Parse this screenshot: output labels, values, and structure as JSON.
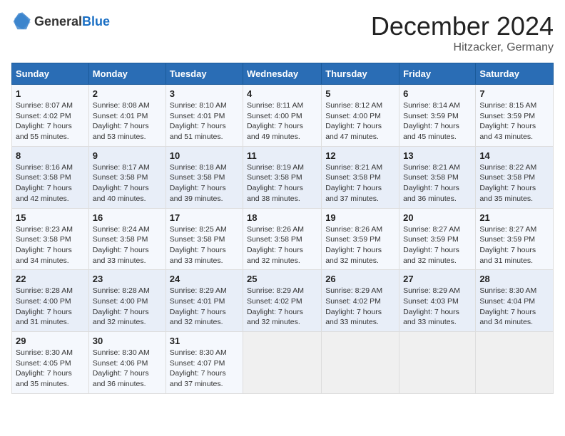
{
  "header": {
    "logo_general": "General",
    "logo_blue": "Blue",
    "month": "December 2024",
    "location": "Hitzacker, Germany"
  },
  "weekdays": [
    "Sunday",
    "Monday",
    "Tuesday",
    "Wednesday",
    "Thursday",
    "Friday",
    "Saturday"
  ],
  "weeks": [
    [
      {
        "day": "1",
        "sunrise": "Sunrise: 8:07 AM",
        "sunset": "Sunset: 4:02 PM",
        "daylight": "Daylight: 7 hours and 55 minutes."
      },
      {
        "day": "2",
        "sunrise": "Sunrise: 8:08 AM",
        "sunset": "Sunset: 4:01 PM",
        "daylight": "Daylight: 7 hours and 53 minutes."
      },
      {
        "day": "3",
        "sunrise": "Sunrise: 8:10 AM",
        "sunset": "Sunset: 4:01 PM",
        "daylight": "Daylight: 7 hours and 51 minutes."
      },
      {
        "day": "4",
        "sunrise": "Sunrise: 8:11 AM",
        "sunset": "Sunset: 4:00 PM",
        "daylight": "Daylight: 7 hours and 49 minutes."
      },
      {
        "day": "5",
        "sunrise": "Sunrise: 8:12 AM",
        "sunset": "Sunset: 4:00 PM",
        "daylight": "Daylight: 7 hours and 47 minutes."
      },
      {
        "day": "6",
        "sunrise": "Sunrise: 8:14 AM",
        "sunset": "Sunset: 3:59 PM",
        "daylight": "Daylight: 7 hours and 45 minutes."
      },
      {
        "day": "7",
        "sunrise": "Sunrise: 8:15 AM",
        "sunset": "Sunset: 3:59 PM",
        "daylight": "Daylight: 7 hours and 43 minutes."
      }
    ],
    [
      {
        "day": "8",
        "sunrise": "Sunrise: 8:16 AM",
        "sunset": "Sunset: 3:58 PM",
        "daylight": "Daylight: 7 hours and 42 minutes."
      },
      {
        "day": "9",
        "sunrise": "Sunrise: 8:17 AM",
        "sunset": "Sunset: 3:58 PM",
        "daylight": "Daylight: 7 hours and 40 minutes."
      },
      {
        "day": "10",
        "sunrise": "Sunrise: 8:18 AM",
        "sunset": "Sunset: 3:58 PM",
        "daylight": "Daylight: 7 hours and 39 minutes."
      },
      {
        "day": "11",
        "sunrise": "Sunrise: 8:19 AM",
        "sunset": "Sunset: 3:58 PM",
        "daylight": "Daylight: 7 hours and 38 minutes."
      },
      {
        "day": "12",
        "sunrise": "Sunrise: 8:21 AM",
        "sunset": "Sunset: 3:58 PM",
        "daylight": "Daylight: 7 hours and 37 minutes."
      },
      {
        "day": "13",
        "sunrise": "Sunrise: 8:21 AM",
        "sunset": "Sunset: 3:58 PM",
        "daylight": "Daylight: 7 hours and 36 minutes."
      },
      {
        "day": "14",
        "sunrise": "Sunrise: 8:22 AM",
        "sunset": "Sunset: 3:58 PM",
        "daylight": "Daylight: 7 hours and 35 minutes."
      }
    ],
    [
      {
        "day": "15",
        "sunrise": "Sunrise: 8:23 AM",
        "sunset": "Sunset: 3:58 PM",
        "daylight": "Daylight: 7 hours and 34 minutes."
      },
      {
        "day": "16",
        "sunrise": "Sunrise: 8:24 AM",
        "sunset": "Sunset: 3:58 PM",
        "daylight": "Daylight: 7 hours and 33 minutes."
      },
      {
        "day": "17",
        "sunrise": "Sunrise: 8:25 AM",
        "sunset": "Sunset: 3:58 PM",
        "daylight": "Daylight: 7 hours and 33 minutes."
      },
      {
        "day": "18",
        "sunrise": "Sunrise: 8:26 AM",
        "sunset": "Sunset: 3:58 PM",
        "daylight": "Daylight: 7 hours and 32 minutes."
      },
      {
        "day": "19",
        "sunrise": "Sunrise: 8:26 AM",
        "sunset": "Sunset: 3:59 PM",
        "daylight": "Daylight: 7 hours and 32 minutes."
      },
      {
        "day": "20",
        "sunrise": "Sunrise: 8:27 AM",
        "sunset": "Sunset: 3:59 PM",
        "daylight": "Daylight: 7 hours and 32 minutes."
      },
      {
        "day": "21",
        "sunrise": "Sunrise: 8:27 AM",
        "sunset": "Sunset: 3:59 PM",
        "daylight": "Daylight: 7 hours and 31 minutes."
      }
    ],
    [
      {
        "day": "22",
        "sunrise": "Sunrise: 8:28 AM",
        "sunset": "Sunset: 4:00 PM",
        "daylight": "Daylight: 7 hours and 31 minutes."
      },
      {
        "day": "23",
        "sunrise": "Sunrise: 8:28 AM",
        "sunset": "Sunset: 4:00 PM",
        "daylight": "Daylight: 7 hours and 32 minutes."
      },
      {
        "day": "24",
        "sunrise": "Sunrise: 8:29 AM",
        "sunset": "Sunset: 4:01 PM",
        "daylight": "Daylight: 7 hours and 32 minutes."
      },
      {
        "day": "25",
        "sunrise": "Sunrise: 8:29 AM",
        "sunset": "Sunset: 4:02 PM",
        "daylight": "Daylight: 7 hours and 32 minutes."
      },
      {
        "day": "26",
        "sunrise": "Sunrise: 8:29 AM",
        "sunset": "Sunset: 4:02 PM",
        "daylight": "Daylight: 7 hours and 33 minutes."
      },
      {
        "day": "27",
        "sunrise": "Sunrise: 8:29 AM",
        "sunset": "Sunset: 4:03 PM",
        "daylight": "Daylight: 7 hours and 33 minutes."
      },
      {
        "day": "28",
        "sunrise": "Sunrise: 8:30 AM",
        "sunset": "Sunset: 4:04 PM",
        "daylight": "Daylight: 7 hours and 34 minutes."
      }
    ],
    [
      {
        "day": "29",
        "sunrise": "Sunrise: 8:30 AM",
        "sunset": "Sunset: 4:05 PM",
        "daylight": "Daylight: 7 hours and 35 minutes."
      },
      {
        "day": "30",
        "sunrise": "Sunrise: 8:30 AM",
        "sunset": "Sunset: 4:06 PM",
        "daylight": "Daylight: 7 hours and 36 minutes."
      },
      {
        "day": "31",
        "sunrise": "Sunrise: 8:30 AM",
        "sunset": "Sunset: 4:07 PM",
        "daylight": "Daylight: 7 hours and 37 minutes."
      },
      null,
      null,
      null,
      null
    ]
  ]
}
